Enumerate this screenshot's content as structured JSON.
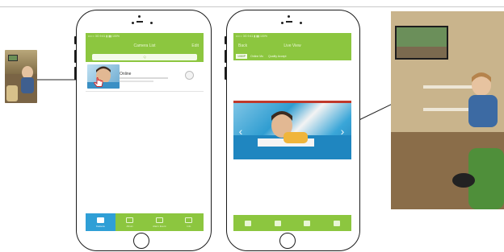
{
  "phone1": {
    "status_text": "•••○○ 3G    9:41    ▮ ▮▮ 100%",
    "nav_title": "Camera List",
    "nav_right": "Edit",
    "search_placeholder": "Q",
    "camera": {
      "status": "Online",
      "meta": ""
    },
    "tabs": [
      {
        "label": "Camera",
        "active": true
      },
      {
        "label": "Album",
        "active": false
      },
      {
        "label": "Alarm Event",
        "active": false
      },
      {
        "label": "Info",
        "active": false
      }
    ]
  },
  "phone2": {
    "status_text": "•••○○ 3G    9:41    ▮ ▮▮ 100%",
    "nav_left": "Back",
    "nav_title": "Live View",
    "segments": [
      "1080P",
      "Online Mo",
      "Quality Accept"
    ],
    "controls": [
      "speaker-icon",
      "camera-icon",
      "album-icon",
      "record-icon"
    ]
  },
  "colors": {
    "green": "#8cc63f",
    "blue": "#2f9fd6",
    "video_blue": "#2f9dd1"
  }
}
